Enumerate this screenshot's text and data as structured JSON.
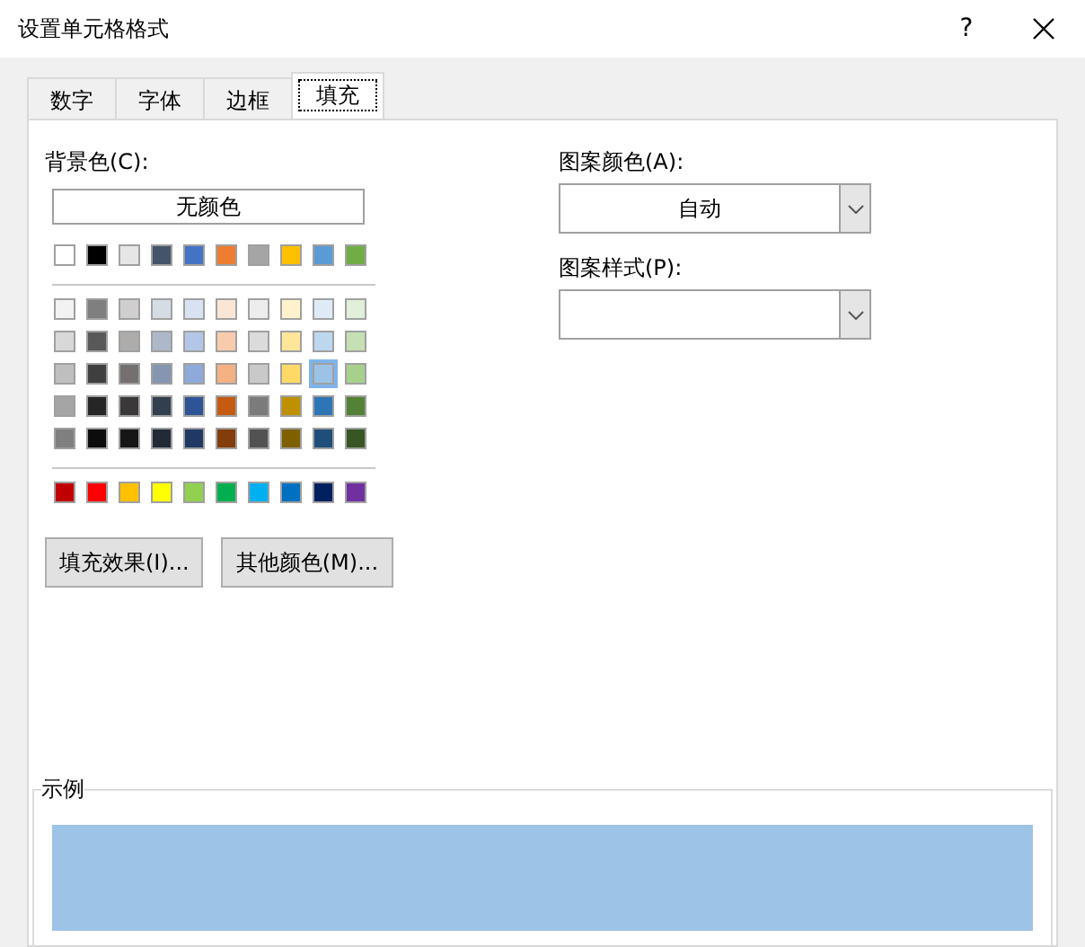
{
  "window": {
    "title": "设置单元格格式",
    "help": "?"
  },
  "tabs": [
    {
      "label": "数字",
      "selected": false
    },
    {
      "label": "字体",
      "selected": false
    },
    {
      "label": "边框",
      "selected": false
    },
    {
      "label": "填充",
      "selected": true
    }
  ],
  "background": {
    "label": "背景色(C):",
    "no_color_button": "无颜色",
    "theme_colors": [
      [
        {
          "color": "#ffffff",
          "selected": false
        },
        {
          "color": "#000000",
          "selected": false
        },
        {
          "color": "#e7e6e6",
          "selected": false
        },
        {
          "color": "#44546a",
          "selected": false
        },
        {
          "color": "#4472c4",
          "selected": false
        },
        {
          "color": "#ed7d31",
          "selected": false
        },
        {
          "color": "#a5a5a5",
          "selected": false
        },
        {
          "color": "#ffc000",
          "selected": false
        },
        {
          "color": "#5b9bd5",
          "selected": false
        },
        {
          "color": "#70ad47",
          "selected": false
        }
      ],
      [
        {
          "color": "#f2f2f2",
          "selected": false
        },
        {
          "color": "#7f7f7f",
          "selected": false
        },
        {
          "color": "#d0cece",
          "selected": false
        },
        {
          "color": "#d6dce4",
          "selected": false
        },
        {
          "color": "#d9e2f3",
          "selected": false
        },
        {
          "color": "#fbe5d5",
          "selected": false
        },
        {
          "color": "#ededed",
          "selected": false
        },
        {
          "color": "#fff2cc",
          "selected": false
        },
        {
          "color": "#deebf6",
          "selected": false
        },
        {
          "color": "#e2efd9",
          "selected": false
        }
      ],
      [
        {
          "color": "#d8d8d8",
          "selected": false
        },
        {
          "color": "#595959",
          "selected": false
        },
        {
          "color": "#aeabab",
          "selected": false
        },
        {
          "color": "#adb9ca",
          "selected": false
        },
        {
          "color": "#b4c6e7",
          "selected": false
        },
        {
          "color": "#f7cbac",
          "selected": false
        },
        {
          "color": "#dbdbdb",
          "selected": false
        },
        {
          "color": "#fee599",
          "selected": false
        },
        {
          "color": "#bdd7ee",
          "selected": false
        },
        {
          "color": "#c5e0b3",
          "selected": false
        }
      ],
      [
        {
          "color": "#bfbfbf",
          "selected": false
        },
        {
          "color": "#3f3f3f",
          "selected": false
        },
        {
          "color": "#757070",
          "selected": false
        },
        {
          "color": "#8496b0",
          "selected": false
        },
        {
          "color": "#8eaadb",
          "selected": false
        },
        {
          "color": "#f4b183",
          "selected": false
        },
        {
          "color": "#c9c9c9",
          "selected": false
        },
        {
          "color": "#ffd965",
          "selected": false
        },
        {
          "color": "#9cc3e5",
          "selected": true
        },
        {
          "color": "#a8d08d",
          "selected": false
        }
      ],
      [
        {
          "color": "#a5a5a5",
          "selected": false
        },
        {
          "color": "#262626",
          "selected": false
        },
        {
          "color": "#3a3838",
          "selected": false
        },
        {
          "color": "#323f4f",
          "selected": false
        },
        {
          "color": "#2f5496",
          "selected": false
        },
        {
          "color": "#c55a11",
          "selected": false
        },
        {
          "color": "#7b7b7b",
          "selected": false
        },
        {
          "color": "#bf9000",
          "selected": false
        },
        {
          "color": "#2e75b5",
          "selected": false
        },
        {
          "color": "#538135",
          "selected": false
        }
      ],
      [
        {
          "color": "#7f7f7f",
          "selected": false
        },
        {
          "color": "#0c0c0c",
          "selected": false
        },
        {
          "color": "#171616",
          "selected": false
        },
        {
          "color": "#222a35",
          "selected": false
        },
        {
          "color": "#1f3864",
          "selected": false
        },
        {
          "color": "#833c0b",
          "selected": false
        },
        {
          "color": "#525252",
          "selected": false
        },
        {
          "color": "#7f6000",
          "selected": false
        },
        {
          "color": "#1e4e79",
          "selected": false
        },
        {
          "color": "#375623",
          "selected": false
        }
      ]
    ],
    "standard_colors": [
      {
        "color": "#c00000",
        "selected": false
      },
      {
        "color": "#ff0000",
        "selected": false
      },
      {
        "color": "#ffc000",
        "selected": false
      },
      {
        "color": "#ffff00",
        "selected": false
      },
      {
        "color": "#92d050",
        "selected": false
      },
      {
        "color": "#00b050",
        "selected": false
      },
      {
        "color": "#00b0f0",
        "selected": false
      },
      {
        "color": "#0070c0",
        "selected": false
      },
      {
        "color": "#002060",
        "selected": false
      },
      {
        "color": "#7030a0",
        "selected": false
      }
    ]
  },
  "buttons": [
    "填充效果(I)...",
    "其他颜色(M)..."
  ],
  "pattern_color": {
    "label": "图案颜色(A):",
    "value": "自动"
  },
  "pattern_style": {
    "label": "图案样式(P):"
  },
  "sample": {
    "label": "示例",
    "color": "#9dc3e6"
  }
}
